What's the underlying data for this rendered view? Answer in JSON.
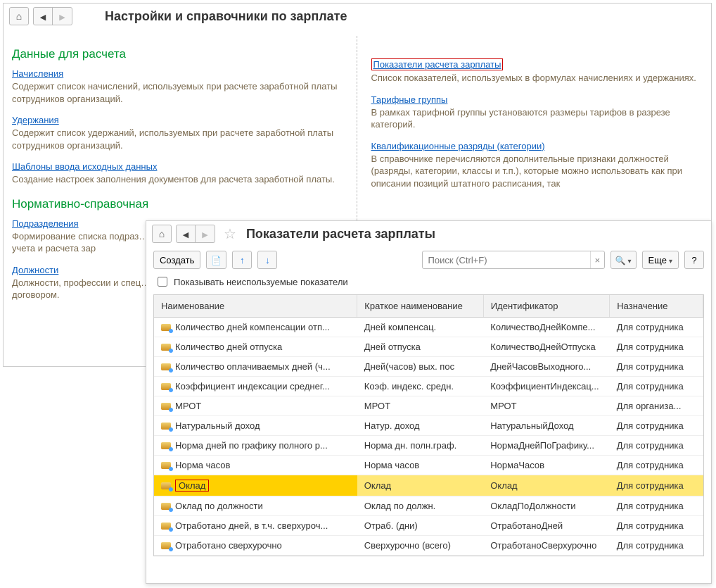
{
  "back": {
    "title": "Настройки и справочники по зарплате",
    "section1": "Данные для расчета",
    "section2": "Нормативно-справочная",
    "left": {
      "link1": "Начисления",
      "desc1": "Содержит список начислений, используемых при расчете заработной платы сотрудников организаций.",
      "link2": "Удержания",
      "desc2": "Содержит список удержаний, используемых при расчете заработной платы сотрудников организаций.",
      "link3": "Шаблоны ввода исходных данных",
      "desc3": "Создание настроек заполнения документов для расчета заработной платы.",
      "link4": "Подразделения",
      "desc4": "Формирование списка подраз… Справочник «Подразделения» кадрового учета и расчета зар",
      "link5": "Должности",
      "desc5": "Должности, профессии и спец… сотрудники выполняют в орган… трудовым договором."
    },
    "right": {
      "link1": "Показатели расчета зарплаты",
      "desc1": "Список показателей, используемых в формулах начислениях и удержаниях.",
      "link2": "Тарифные группы",
      "desc2": "В рамках тарифной группы установаются размеры тарифов в разрезе категорий.",
      "link3": "Квалификационные разряды (категории)",
      "desc3": "В справочнике перечисляются дополнительные признаки должностей (разряды, категории, классы и т.п.), которые можно использовать как при описании позиций штатного расписания, так"
    }
  },
  "front": {
    "title": "Показатели расчета зарплаты",
    "toolbar": {
      "create": "Создать",
      "more": "Еще",
      "help": "?",
      "search_ph": "Поиск (Ctrl+F)"
    },
    "checkbox_label": "Показывать неиспользуемые показатели",
    "columns": {
      "c1": "Наименование",
      "c2": "Краткое наименование",
      "c3": "Идентификатор",
      "c4": "Назначение"
    },
    "rows": [
      {
        "name": "Количество дней компенсации отп...",
        "short": "Дней компенсац.",
        "id": "КоличествоДнейКомпе...",
        "dest": "Для сотрудника"
      },
      {
        "name": "Количество дней отпуска",
        "short": "Дней отпуска",
        "id": "КоличествоДнейОтпуска",
        "dest": "Для сотрудника"
      },
      {
        "name": "Количество оплачиваемых дней (ч...",
        "short": "Дней(часов) вых. пос",
        "id": "ДнейЧасовВыходного...",
        "dest": "Для сотрудника"
      },
      {
        "name": "Коэффициент индексации среднег...",
        "short": "Коэф. индекс. средн.",
        "id": "КоэффициентИндексац...",
        "dest": "Для сотрудника"
      },
      {
        "name": "МРОТ",
        "short": "МРОТ",
        "id": "МРОТ",
        "dest": "Для организа..."
      },
      {
        "name": "Натуральный доход",
        "short": "Натур. доход",
        "id": "НатуральныйДоход",
        "dest": "Для сотрудника"
      },
      {
        "name": "Норма дней по графику полного р...",
        "short": "Норма дн. полн.граф.",
        "id": "НормаДнейПоГрафику...",
        "dest": "Для сотрудника"
      },
      {
        "name": "Норма часов",
        "short": "Норма часов",
        "id": "НормаЧасов",
        "dest": "Для сотрудника"
      },
      {
        "name": "Оклад",
        "short": "Оклад",
        "id": "Оклад",
        "dest": "Для сотрудника",
        "selected": true,
        "hl": true
      },
      {
        "name": "Оклад по должности",
        "short": "Оклад по должн.",
        "id": "ОкладПоДолжности",
        "dest": "Для сотрудника"
      },
      {
        "name": "Отработано дней, в т.ч. сверхуроч...",
        "short": "Отраб. (дни)",
        "id": "ОтработаноДней",
        "dest": "Для сотрудника"
      },
      {
        "name": "Отработано сверхурочно",
        "short": "Сверхурочно (всего)",
        "id": "ОтработаноСверхурочно",
        "dest": "Для сотрудника"
      }
    ]
  }
}
